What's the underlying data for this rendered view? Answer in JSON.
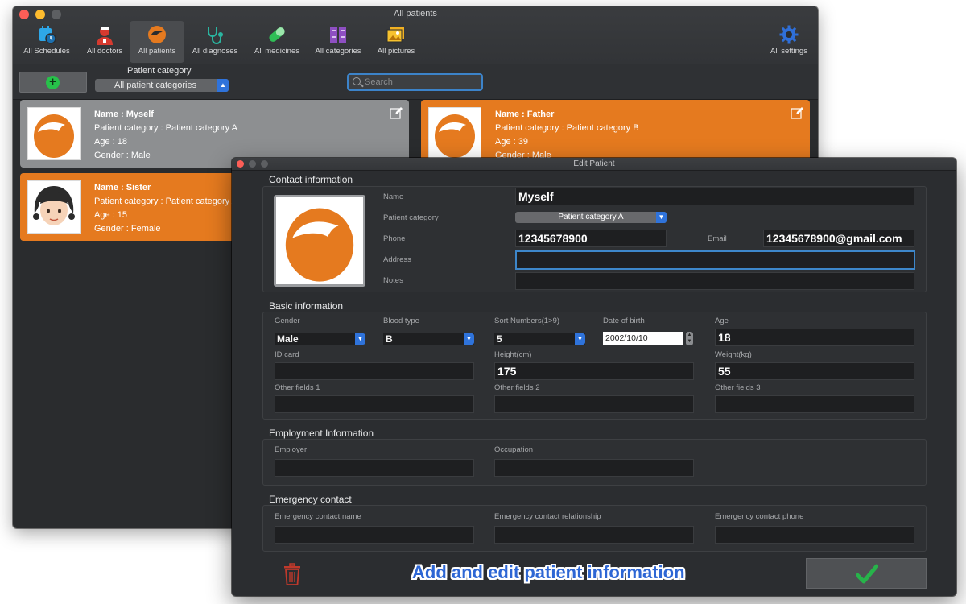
{
  "main_window": {
    "title": "All patients",
    "toolbar": [
      {
        "label": "All Schedules",
        "icon": "calendar-clock-icon"
      },
      {
        "label": "All doctors",
        "icon": "doctor-icon"
      },
      {
        "label": "All patients",
        "icon": "patient-icon",
        "active": true
      },
      {
        "label": "All diagnoses",
        "icon": "stethoscope-icon"
      },
      {
        "label": "All medicines",
        "icon": "pill-icon"
      },
      {
        "label": "All categories",
        "icon": "categories-icon"
      },
      {
        "label": "All pictures",
        "icon": "pictures-icon"
      },
      {
        "label": "All settings",
        "icon": "gear-icon"
      }
    ],
    "add_button_icon": "plus-circle-icon",
    "patient_category_label": "Patient category",
    "patient_category_value": "All patient categories",
    "search_placeholder": "Search",
    "patients": [
      {
        "name": "Name : Myself",
        "category": "Patient category : Patient category A",
        "age": "Age : 18",
        "gender": "Gender : Male",
        "color": "#8d8f91",
        "avatar": "orange-head-avatar"
      },
      {
        "name": "Name : Father",
        "category": "Patient category : Patient category B",
        "age": "Age : 39",
        "gender": "Gender : Male",
        "color": "#e57a1f",
        "avatar": "orange-head-avatar"
      },
      {
        "name": "Name : Sister",
        "category": "Patient category : Patient category A",
        "age": "Age : 15",
        "gender": "Gender : Female",
        "color": "#e57a1f",
        "avatar": "girl-emoji-avatar"
      }
    ]
  },
  "dialog": {
    "title": "Edit Patient",
    "contact": {
      "section_title": "Contact information",
      "name_label": "Name",
      "name_value": "Myself",
      "category_label": "Patient category",
      "category_value": "Patient category A",
      "phone_label": "Phone",
      "phone_value": "12345678900",
      "email_label": "Email",
      "email_value": "12345678900@gmail.com",
      "address_label": "Address",
      "address_value": "",
      "notes_label": "Notes",
      "notes_value": ""
    },
    "basic": {
      "section_title": "Basic information",
      "gender_label": "Gender",
      "gender_value": "Male",
      "blood_label": "Blood type",
      "blood_value": "B",
      "sort_label": "Sort Numbers(1>9)",
      "sort_value": "5",
      "dob_label": "Date of birth",
      "dob_value": "2002/10/10",
      "age_label": "Age",
      "age_value": "18",
      "idcard_label": "ID card",
      "idcard_value": "",
      "height_label": "Height(cm)",
      "height_value": "175",
      "weight_label": "Weight(kg)",
      "weight_value": "55",
      "other1_label": "Other fields 1",
      "other1_value": "",
      "other2_label": "Other fields 2",
      "other2_value": "",
      "other3_label": "Other fields 3",
      "other3_value": ""
    },
    "employment": {
      "section_title": "Employment Information",
      "employer_label": "Employer",
      "employer_value": "",
      "occupation_label": "Occupation",
      "occupation_value": ""
    },
    "emergency": {
      "section_title": "Emergency contact",
      "name_label": "Emergency contact name",
      "name_value": "",
      "relationship_label": "Emergency contact relationship",
      "relationship_value": "",
      "phone_label": "Emergency contact phone",
      "phone_value": ""
    },
    "caption": "Add and edit patient information",
    "delete_icon": "trash-icon",
    "confirm_icon": "checkmark-icon"
  },
  "colors": {
    "accent_orange": "#e57a1f",
    "select_blue": "#2f73db",
    "confirm_green": "#27b34a",
    "delete_red": "#c0392b"
  }
}
